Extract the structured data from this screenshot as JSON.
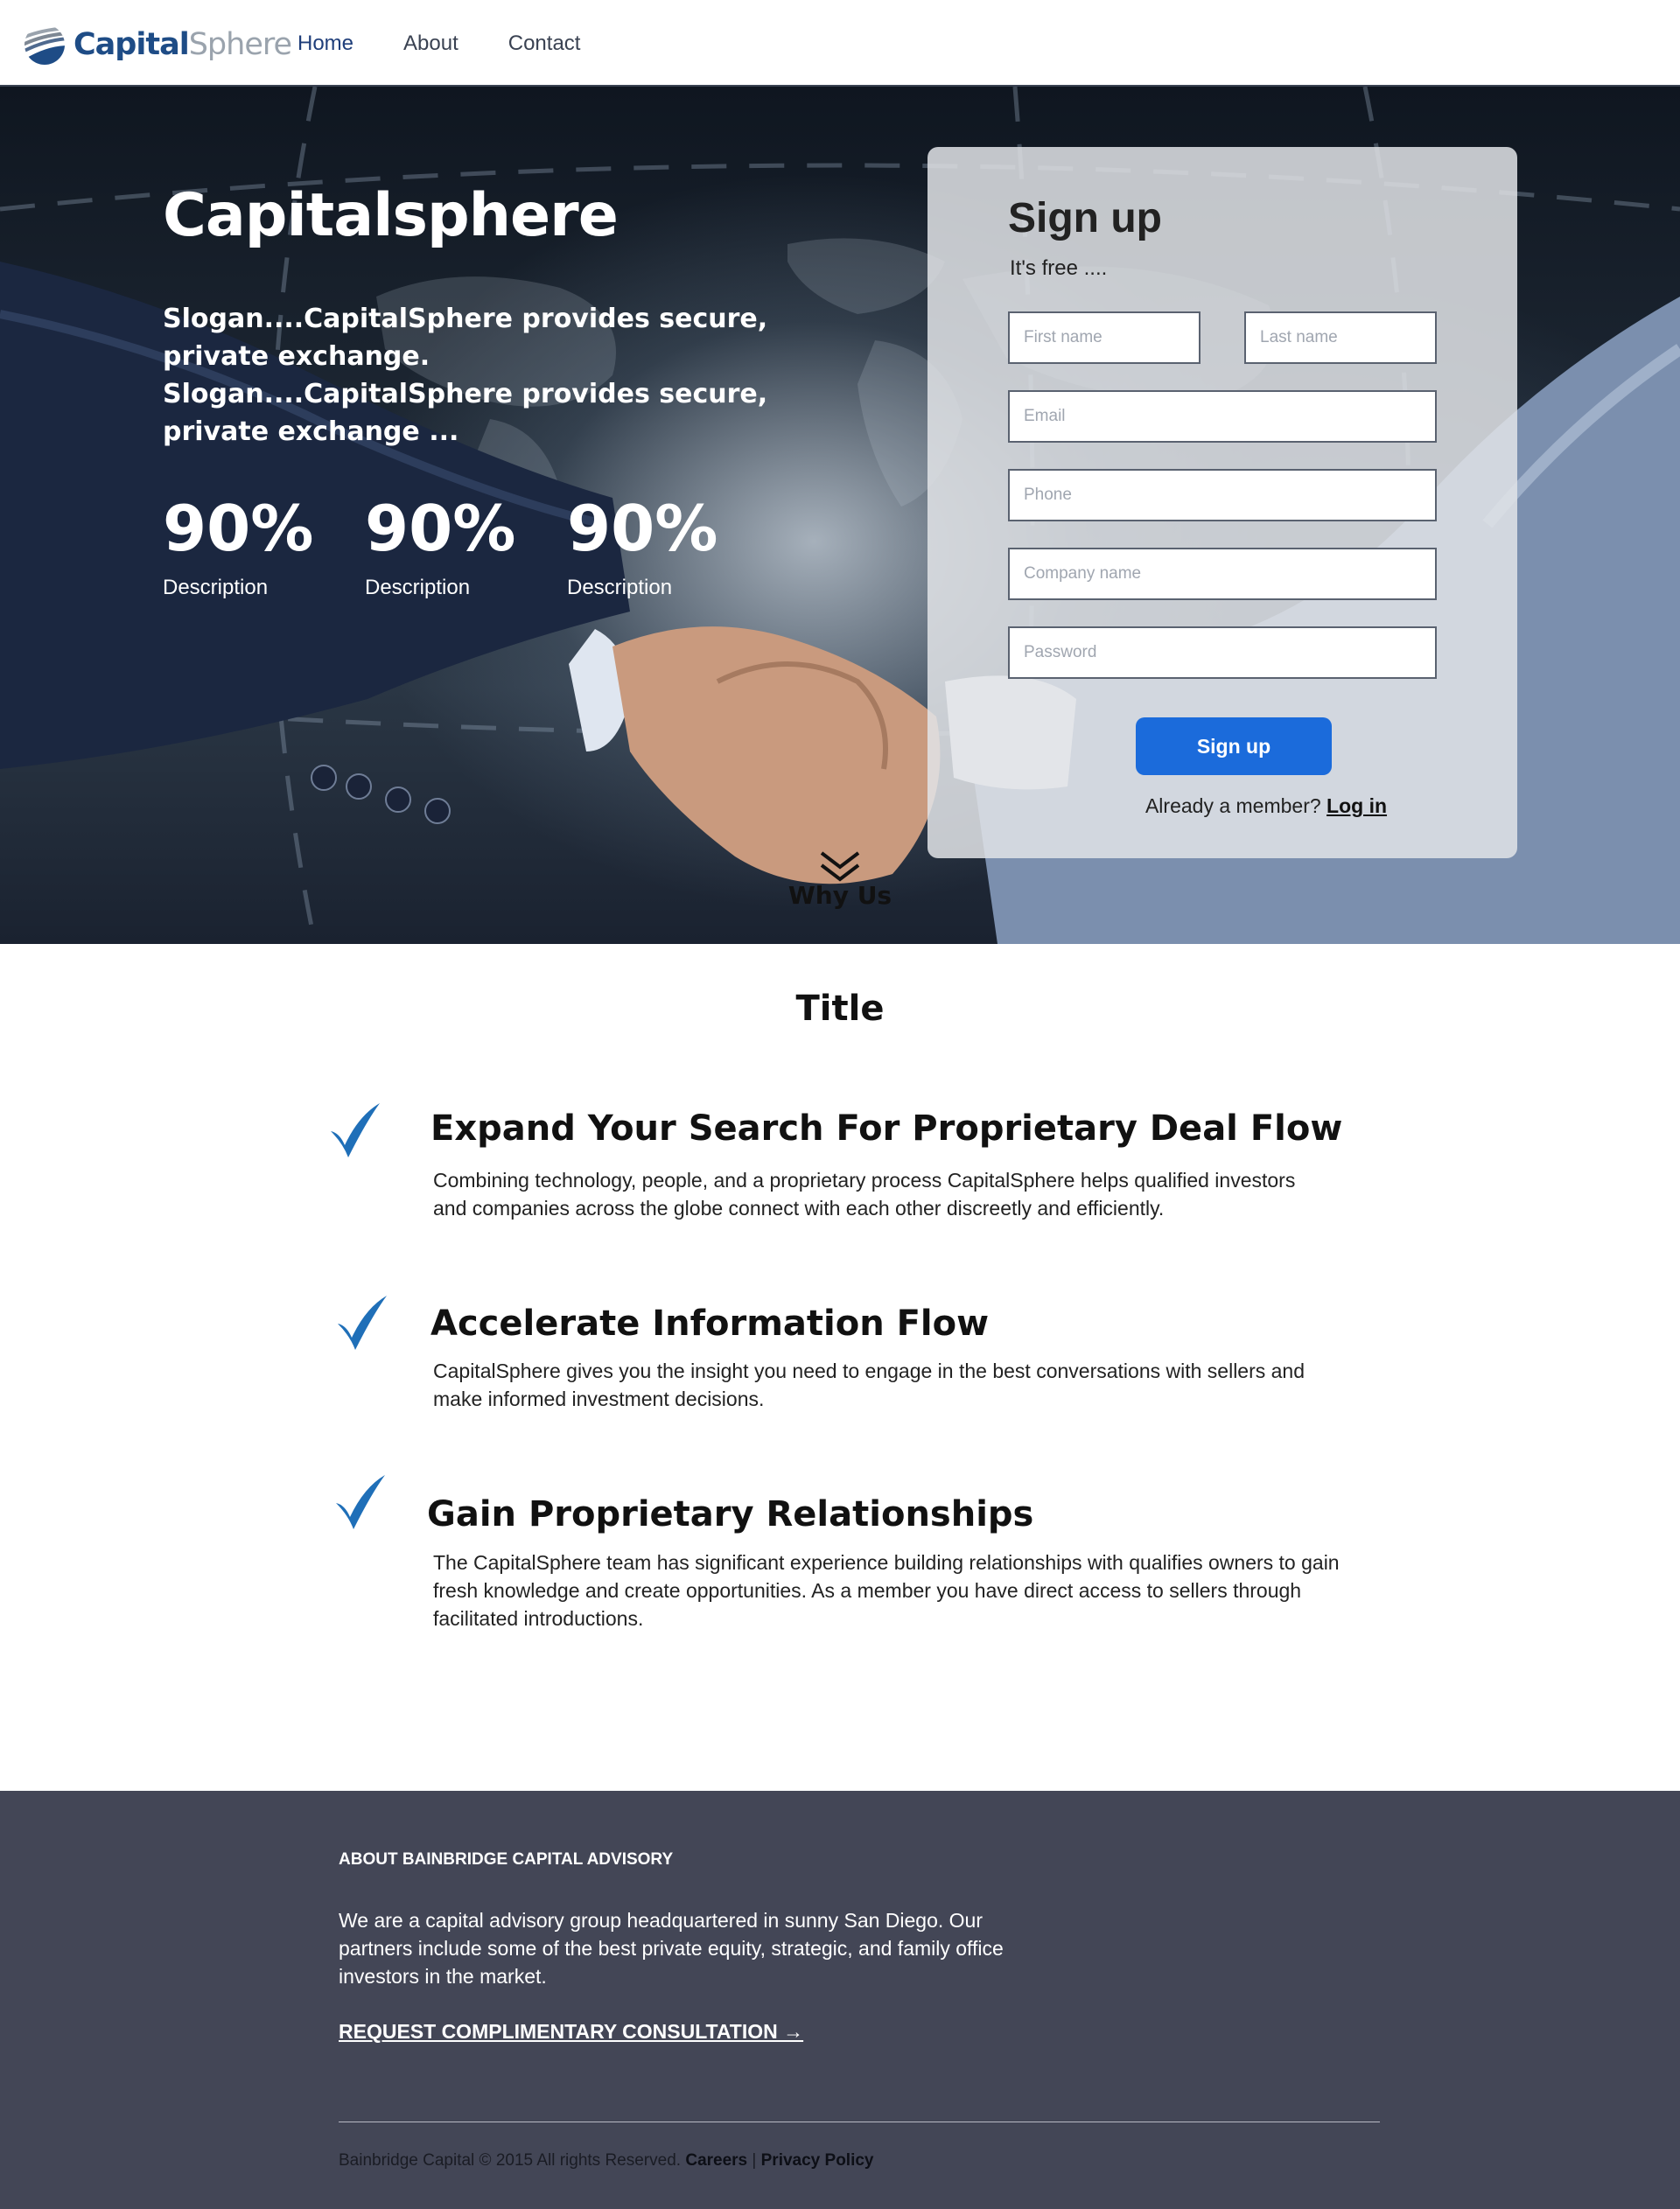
{
  "nav": {
    "logo_bold": "Capital",
    "logo_light": "Sphere",
    "links": [
      {
        "label": "Home",
        "active": true
      },
      {
        "label": "About",
        "active": false
      },
      {
        "label": "Contact",
        "active": false
      }
    ]
  },
  "hero": {
    "title": "Capitalsphere",
    "slogan": "Slogan....CapitalSphere provides secure, private exchange. Slogan....CapitalSphere provides secure, private exchange ...",
    "stats": [
      {
        "value": "90%",
        "desc": "Description"
      },
      {
        "value": "90%",
        "desc": "Description"
      },
      {
        "value": "90%",
        "desc": "Description"
      }
    ],
    "why_us": "Why Us"
  },
  "signup": {
    "title": "Sign up",
    "subtitle": "It's free ....",
    "first_name_placeholder": "First name",
    "last_name_placeholder": "Last name",
    "email_placeholder": "Email",
    "phone_placeholder": "Phone",
    "company_placeholder": "Company name",
    "password_placeholder": "Password",
    "button_label": "Sign up",
    "member_text": "Already a member?",
    "login_label": "Log in"
  },
  "features": {
    "section_title": "Title",
    "items": [
      {
        "title": "Expand Your Search For Proprietary Deal Flow",
        "desc": "Combining technology, people, and a proprietary process CapitalSphere helps qualified investors and companies across the globe connect with each other discreetly and efficiently."
      },
      {
        "title": "Accelerate Information Flow",
        "desc": "CapitalSphere gives you the insight you need to engage in the best conversations with sellers and make informed investment decisions."
      },
      {
        "title": "Gain Proprietary Relationships",
        "desc": "The CapitalSphere team has significant experience building relationships with qualifies owners to gain fresh knowledge and create opportunities. As a member you have direct access to sellers through facilitated introductions."
      }
    ]
  },
  "footer": {
    "heading": "ABOUT BAINBRIDGE CAPITAL ADVISORY",
    "text": "We are a capital advisory group headquartered in sunny San Diego. Our partners include some of the best private equity, strategic, and family office investors in the market.",
    "cta": "REQUEST COMPLIMENTARY CONSULTATION →",
    "copyright": "Bainbridge Capital © 2015 All rights Reserved.",
    "careers": "Careers",
    "separator": "|",
    "privacy": "Privacy Policy"
  },
  "colors": {
    "brand_blue": "#1e4c86",
    "button_blue": "#1b6bdb",
    "footer_bg": "#434656",
    "check_blue": "#1f6fb8"
  }
}
